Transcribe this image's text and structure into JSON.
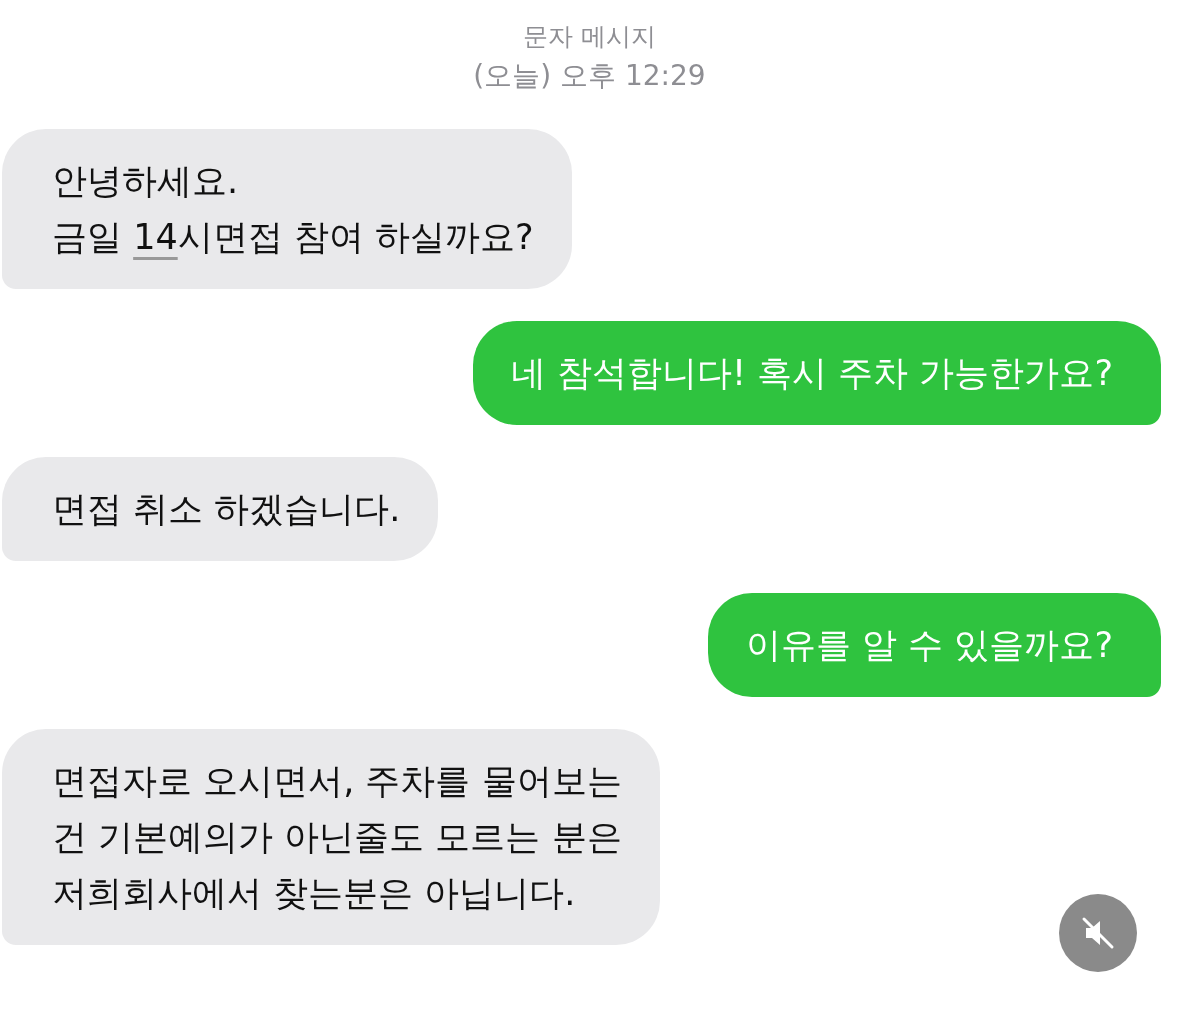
{
  "header": {
    "title": "문자 메시지",
    "timestamp": "(오늘) 오후 12:29"
  },
  "messages": [
    {
      "kind": "received",
      "lines": [
        [
          {
            "text": "안녕하세요."
          }
        ],
        [
          {
            "text": "금일 "
          },
          {
            "text": "14",
            "link": true
          },
          {
            "text": "시면접 참여 하실까요?"
          }
        ]
      ]
    },
    {
      "kind": "sent",
      "lines": [
        [
          {
            "text": "네 참석합니다! 혹시 주차 가능한가요?"
          }
        ]
      ]
    },
    {
      "kind": "received",
      "lines": [
        [
          {
            "text": "면접 취소 하겠습니다."
          }
        ]
      ]
    },
    {
      "kind": "sent",
      "lines": [
        [
          {
            "text": "이유를 알 수 있을까요?"
          }
        ]
      ]
    },
    {
      "kind": "received",
      "lines": [
        [
          {
            "text": "면접자로 오시면서, 주차를 물어보는"
          }
        ],
        [
          {
            "text": "건 기본예의가 아닌줄도 모르는 분은"
          }
        ],
        [
          {
            "text": "저희회사에서 찾는분은 아닙니다."
          }
        ]
      ]
    }
  ],
  "video_control": {
    "muted": true
  }
}
